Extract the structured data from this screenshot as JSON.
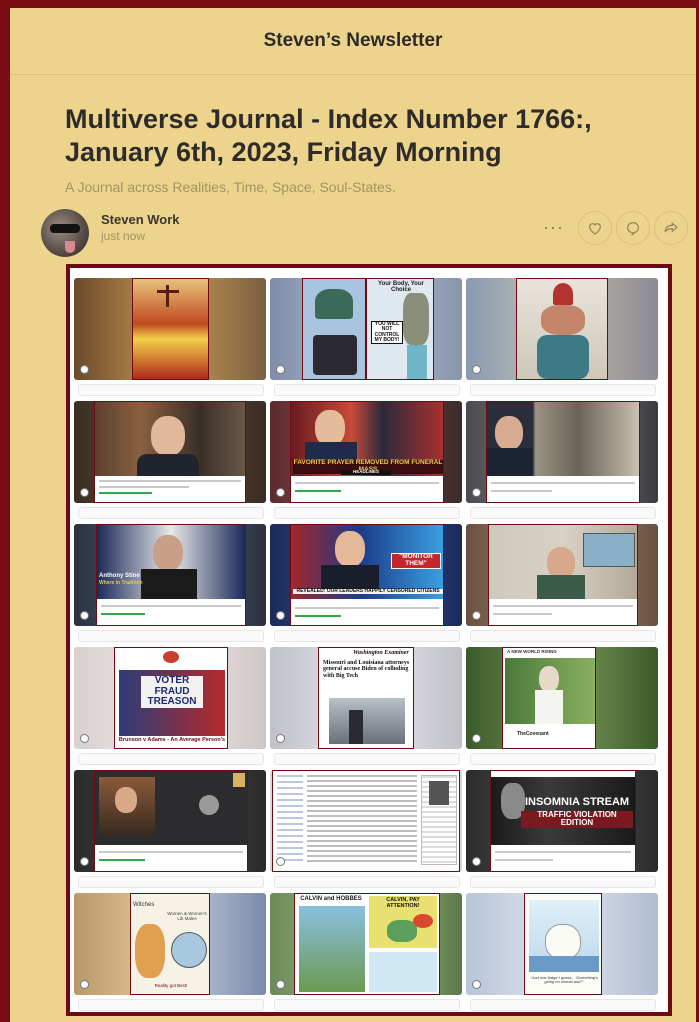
{
  "header": {
    "publication_name": "Steven’s Newsletter"
  },
  "post": {
    "title": "Multiverse Journal - Index Number 1766:, January 6th, 2023, Friday Morning",
    "subtitle": "A Journal across Realities, Time, Space, Soul-States.",
    "author": "Steven Work",
    "date": "just now"
  },
  "actions": {
    "more_icon": "ellipsis-icon",
    "like_icon": "heart-icon",
    "comment_icon": "comment-icon",
    "share_icon": "share-icon"
  },
  "gallery": {
    "tile_texts": {
      "t2_a": "Your Body, Your Choice",
      "t2_b": "YOU WILL NOT CONTROL MY BODY!",
      "t5_headline": "FAVORITE PRAYER REMOVED FROM FUNERAL MASS",
      "t5_tag": "HEADLINES",
      "t7_name": "Anthony Stine",
      "t7_sub": "Where in Tradition",
      "t8_monitor": "\"MONITOR THEM\"",
      "t8_lower": "REVEALED: OUR LEADERS HAPPILY CENSORED CITIZENS",
      "t10_sign": "VOTER FRAUD TREASON",
      "t10_caption": "Brunson v Adams - An Average Person's",
      "t11_masthead": "Washington Examiner",
      "t11_headline": "Missouri and Louisiana attorneys general accuse Biden of colluding with Big Tech",
      "t12_top": "A NEW WORLD RISING",
      "t12_channel": "TheCovenant",
      "t15_big": "INSOMNIA STREAM",
      "t15_sub": "TRAFFIC VIOLATION EDITION",
      "t16_a": "Witches",
      "t16_b": "Women & Women's Lib Males",
      "t16_c": "Reality got Best!",
      "t17_a": "CALVIN and HOBBES",
      "t17_b": "CALVIN, PAY ATTENTION!",
      "t18_caption": "\"Just one ledge I guess... Something's going on should ask?\""
    }
  },
  "colors": {
    "frame": "#7a0d14",
    "page_bg": "#ecd48c",
    "muted_text": "#a39460",
    "title_text": "#2e2b2a"
  }
}
